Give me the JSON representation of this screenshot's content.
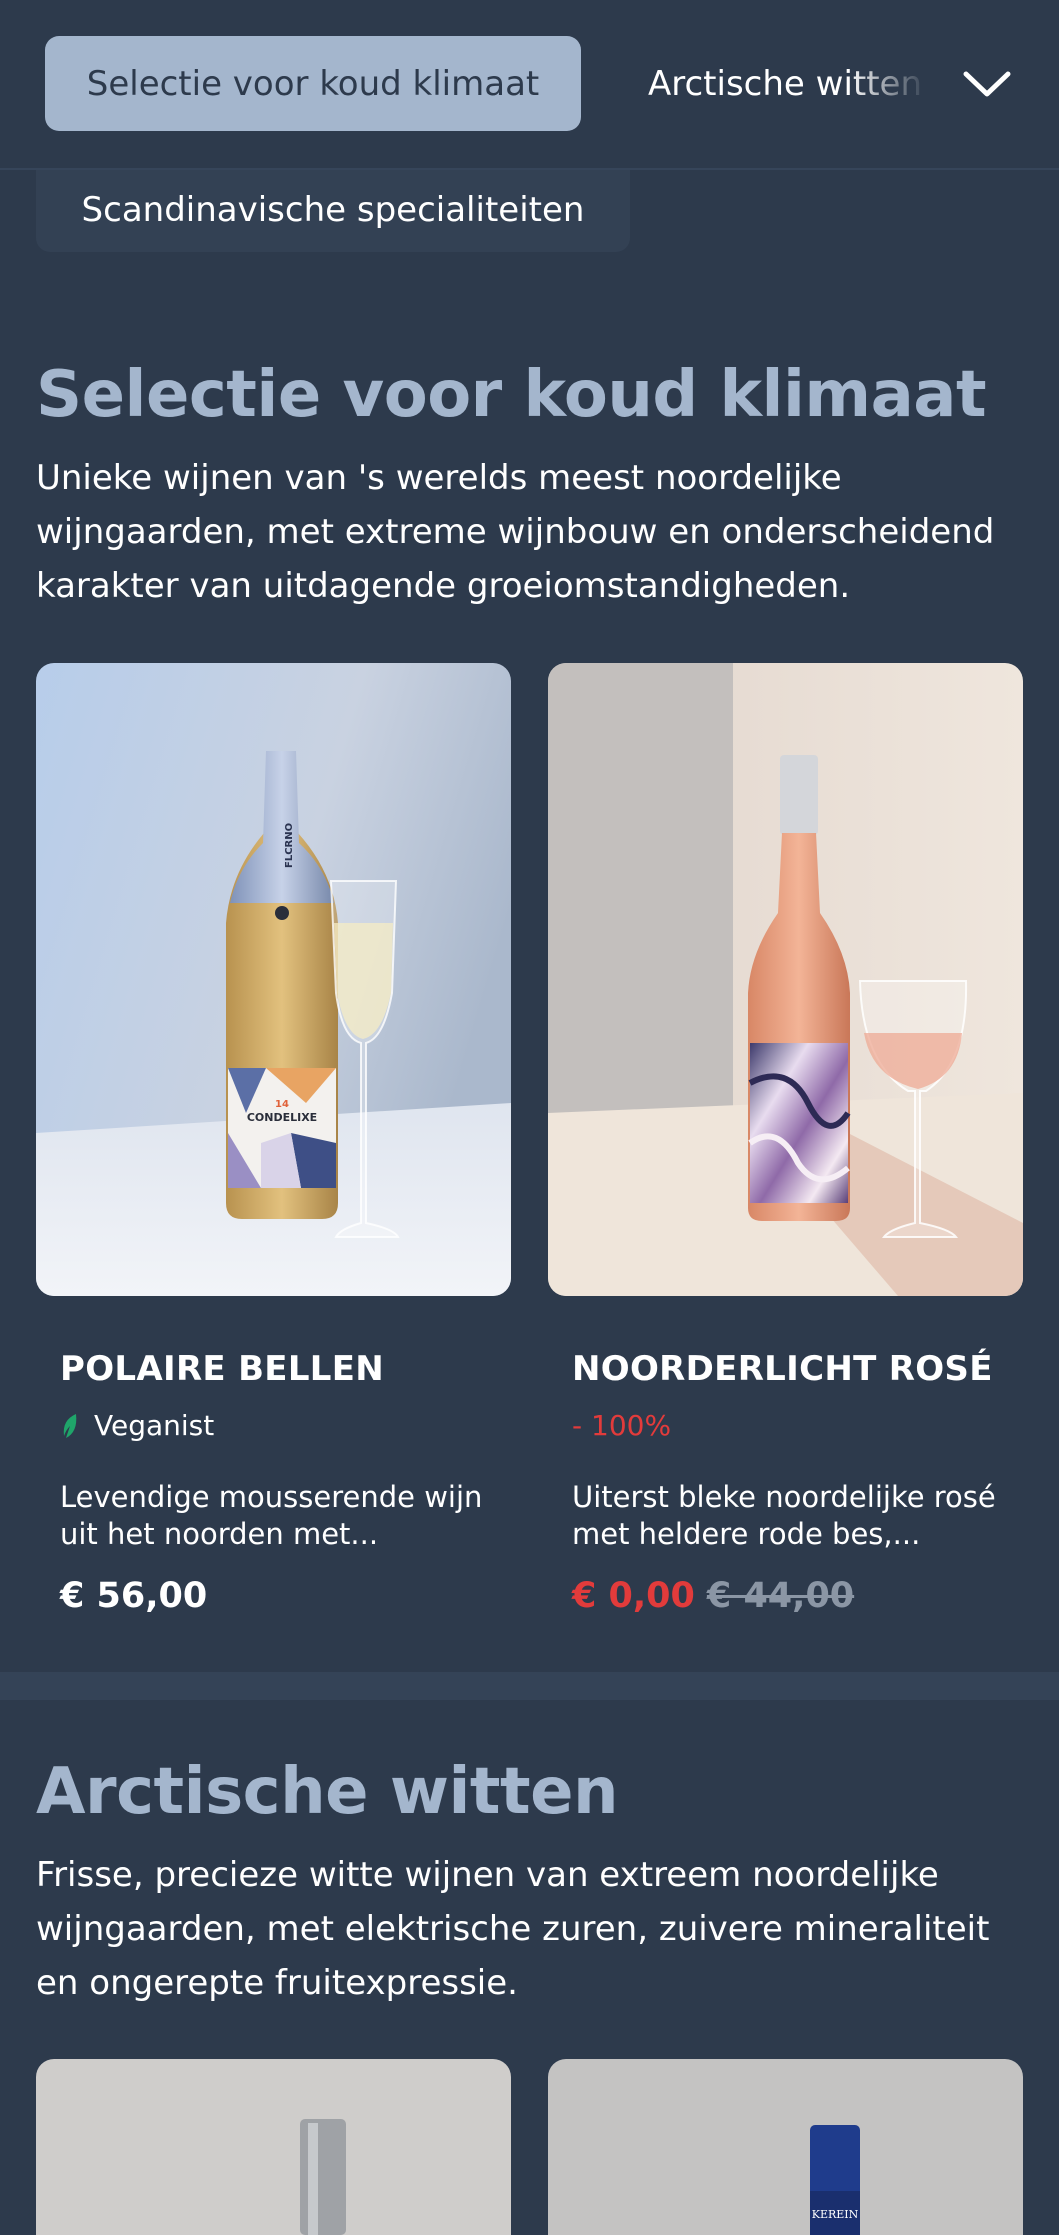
{
  "nav": {
    "active_category": "Selectie voor koud klimaat",
    "next_category": "Arctische witten",
    "second_row_category": "Scandinavische specialiteiten",
    "chevron_icon": "chevron-down-icon"
  },
  "sections": [
    {
      "title": "Selectie voor koud klimaat",
      "description": "Unieke wijnen van 's werelds meest noordelijke wijngaarden, met extreme wijnbouw en onderscheidend karakter van uitdagende groeiomstandigheden.",
      "products": [
        {
          "name": "POLAIRE BELLEN",
          "tag": "Veganist",
          "tag_icon": "leaf-icon",
          "description": "Levendige mousserende wijn uit het noorden met...",
          "price": "€ 56,00",
          "label_text": {
            "brand": "CONDELIXE",
            "number": "14",
            "neck": "FLCRNO"
          }
        },
        {
          "name": "NOORDERLICHT ROSÉ",
          "discount": "- 100%",
          "description": "Uiterst bleke noordelijke rosé met heldere rode bes,...",
          "price": "€ 0,00",
          "old_price": "€ 44,00"
        }
      ]
    },
    {
      "title": "Arctische witten",
      "description": "Frisse, precieze witte wijnen van extreem noordelijke wijngaarden, met elektrische zuren, zuivere mineraliteit en ongerepte fruitexpressie.",
      "products": [
        {
          "label_text": ""
        },
        {
          "label_text": "KEREIN"
        }
      ]
    }
  ],
  "colors": {
    "background": "#2d3a4c",
    "accent": "#a4b6cd",
    "sale": "#e23b3b",
    "vegan": "#1fa56a"
  }
}
